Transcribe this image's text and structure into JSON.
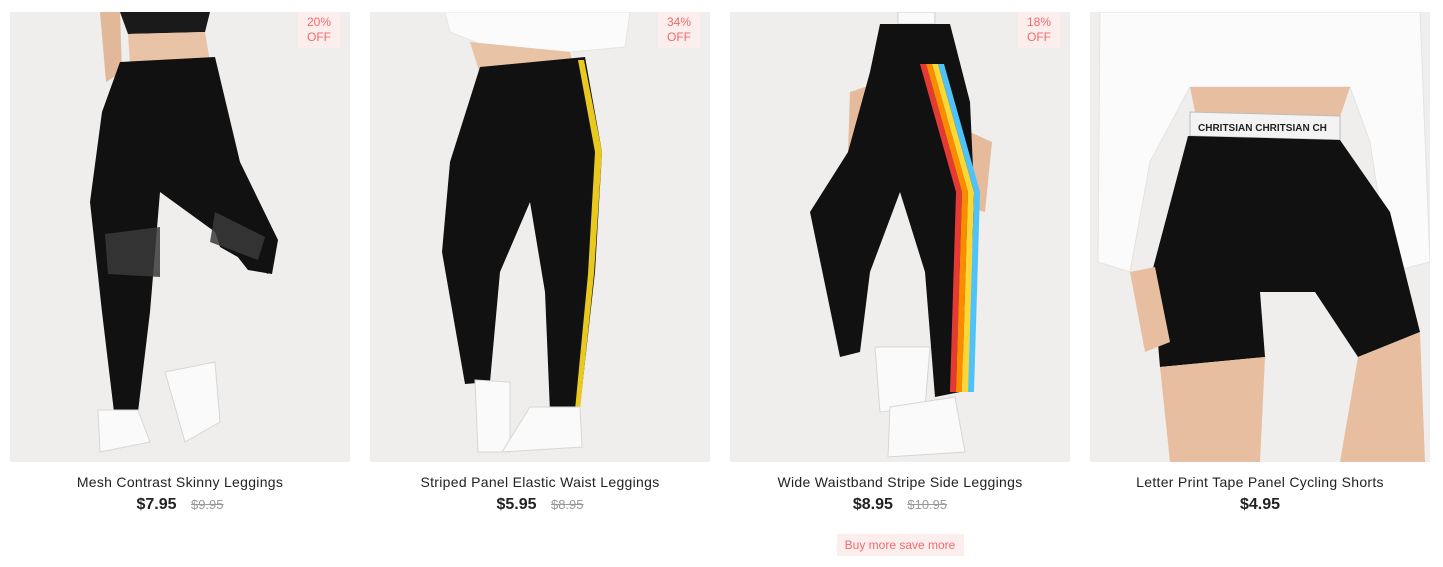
{
  "products": [
    {
      "title": "Mesh Contrast Skinny Leggings",
      "price": "$7.95",
      "old_price": "$9.95",
      "discount_percent": "20%",
      "discount_off": "OFF"
    },
    {
      "title": "Striped Panel Elastic Waist Leggings",
      "price": "$5.95",
      "old_price": "$8.95",
      "discount_percent": "34%",
      "discount_off": "OFF"
    },
    {
      "title": "Wide Waistband Stripe Side Leggings",
      "price": "$8.95",
      "old_price": "$10.95",
      "discount_percent": "18%",
      "discount_off": "OFF",
      "promo": "Buy more save more"
    },
    {
      "title": "Letter Print Tape Panel Cycling Shorts",
      "price": "$4.95",
      "waistband_text": "CHRITSIAN CHRITSIAN CH"
    }
  ],
  "colors": {
    "badge_text": "#f06a6a",
    "badge_bg": "#fdeeee",
    "image_bg": "#efeeec",
    "garment": "#111111"
  }
}
